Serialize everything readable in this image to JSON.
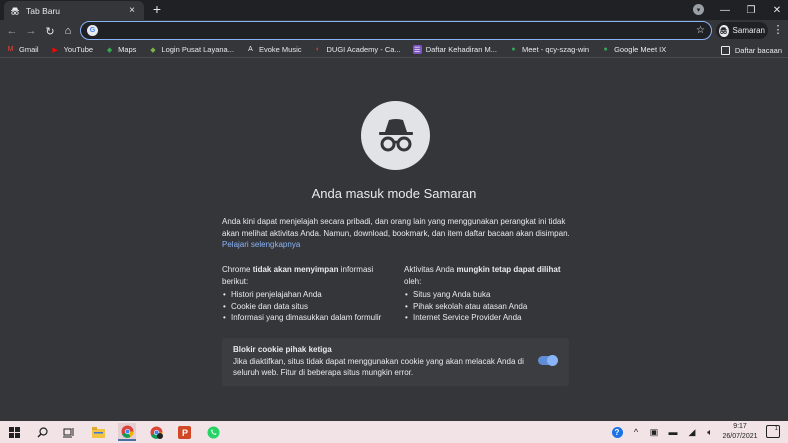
{
  "tab": {
    "title": "Tab Baru",
    "close": "×",
    "new_tab": "+"
  },
  "window": {
    "minimize": "—",
    "restore": "❐",
    "close": "✕"
  },
  "toolbar": {
    "back": "←",
    "forward": "→",
    "reload": "↻",
    "home": "⌂",
    "omnibox_value": "",
    "omnibox_placeholder": "",
    "star": "☆",
    "profile_label": "Samaran",
    "menu": "⋮"
  },
  "bookmarks": {
    "items": [
      {
        "label": "Gmail",
        "icon": "gmail-icon",
        "glyph": "M",
        "color": "#ea4335"
      },
      {
        "label": "YouTube",
        "icon": "youtube-icon",
        "glyph": "▶",
        "color": "#ff0000"
      },
      {
        "label": "Maps",
        "icon": "maps-icon",
        "glyph": "◆",
        "color": "#34a853"
      },
      {
        "label": "Login Pusat Layana...",
        "icon": "bookmark-icon",
        "glyph": "◆",
        "color": "#7cb342"
      },
      {
        "label": "Evoke Music",
        "icon": "evoke-icon",
        "glyph": "A",
        "color": "#e8eaed"
      },
      {
        "label": "DUGI Academy - Ca...",
        "icon": "dugi-icon",
        "glyph": "◐",
        "color": "#e53935"
      },
      {
        "label": "Daftar Kehadiran M...",
        "icon": "forms-icon",
        "glyph": "☰",
        "color": "#7e57c2"
      },
      {
        "label": "Meet - qcy-szag-win",
        "icon": "meet-icon",
        "glyph": "●",
        "color": "#34a853"
      },
      {
        "label": "Google Meet IX",
        "icon": "meet-icon",
        "glyph": "●",
        "color": "#34a853"
      }
    ],
    "reading_list": "Daftar bacaan"
  },
  "main": {
    "headline": "Anda masuk mode Samaran",
    "intro_text": "Anda kini dapat menjelajah secara pribadi, dan orang lain yang menggunakan perangkat ini tidak akan melihat aktivitas Anda. Namun, download, bookmark, dan item daftar bacaan akan disimpan.",
    "learn_more": "Pelajari selengkapnya",
    "left_col": {
      "heading_pre": "Chrome ",
      "heading_bold": "tidak akan menyimpan",
      "heading_post": " informasi berikut:",
      "items": [
        "Histori penjelajahan Anda",
        "Cookie dan data situs",
        "Informasi yang dimasukkan dalam formulir"
      ]
    },
    "right_col": {
      "heading_pre": "Aktivitas Anda ",
      "heading_bold": "mungkin tetap dapat dilihat",
      "heading_post": " oleh:",
      "items": [
        "Situs yang Anda buka",
        "Pihak sekolah atau atasan Anda",
        "Internet Service Provider Anda"
      ]
    },
    "cookie": {
      "title": "Blokir cookie pihak ketiga",
      "desc": "Jika diaktifkan, situs tidak dapat menggunakan cookie yang akan melacak Anda di seluruh web. Fitur di beberapa situs mungkin error.",
      "enabled": true
    }
  },
  "taskbar": {
    "time": "9:17",
    "date": "26/07/2021",
    "notifications": "1"
  },
  "colors": {
    "accent": "#8ab4f8",
    "bg": "#35363a",
    "tabstrip": "#202124",
    "taskbar": "#f2e3e6"
  }
}
